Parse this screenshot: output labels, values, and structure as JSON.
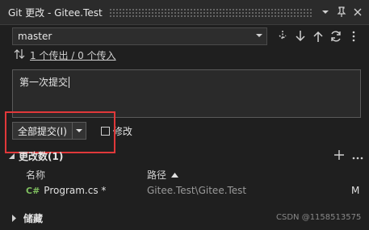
{
  "window": {
    "title": "Git 更改 - Gitee.Test",
    "controls": [
      "chevron-down-icon",
      "pin-icon",
      "close-icon"
    ]
  },
  "branch": {
    "current": "master",
    "actions": [
      "fetch-icon",
      "pull-icon",
      "push-icon",
      "sync-icon",
      "more-icon"
    ]
  },
  "sync": {
    "icon": "arrows-updown-icon",
    "label": "1 个传出 / 0 个传入"
  },
  "commit": {
    "message": "第一次提交",
    "commit_all_label": "全部提交(I)",
    "amend_label": "修改",
    "amend_checked": false,
    "highlight_color": "#e0383a"
  },
  "changes": {
    "header": "更改数(1)",
    "columns": {
      "name": "名称",
      "path": "路径"
    },
    "files": [
      {
        "lang": "C#",
        "name": "Program.cs *",
        "path": "Gitee.Test\\Gitee.Test",
        "status": "M"
      }
    ]
  },
  "stash": {
    "label": "储藏"
  },
  "watermark": "CSDN @1158513575"
}
